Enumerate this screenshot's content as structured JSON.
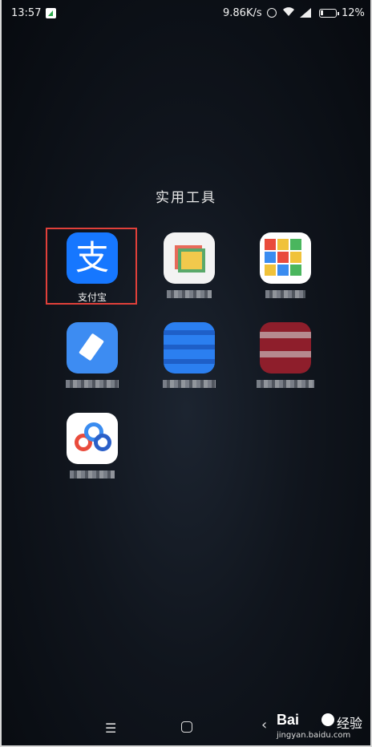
{
  "status_bar": {
    "time": "13:57",
    "network_speed": "9.86K/s",
    "battery_percent": "12%",
    "icons": [
      "notification-icon",
      "alarm-icon",
      "wifi-icon",
      "signal-icon",
      "battery-icon"
    ]
  },
  "folder": {
    "title": "实用工具",
    "apps": [
      {
        "id": "alipay",
        "label": "支付宝",
        "glyph": "支",
        "color": "#1677ff",
        "highlighted": true
      },
      {
        "id": "app-2",
        "label": "",
        "color": "#f3f3f3"
      },
      {
        "id": "app-3",
        "label": "",
        "color": "#ffffff"
      },
      {
        "id": "app-4",
        "label": "",
        "color": "#3d8cf2"
      },
      {
        "id": "app-5",
        "label": "",
        "color": "#2b7ff0"
      },
      {
        "id": "app-6",
        "label": "",
        "color": "#8e1e2b"
      },
      {
        "id": "app-7",
        "label": "",
        "color": "#ffffff"
      }
    ]
  },
  "nav_bar": {
    "menu_glyph": "☰",
    "back_glyph": "‹"
  },
  "watermark": {
    "brand": "Bai",
    "brand_cn": "经验",
    "url": "jingyan.baidu.com"
  }
}
